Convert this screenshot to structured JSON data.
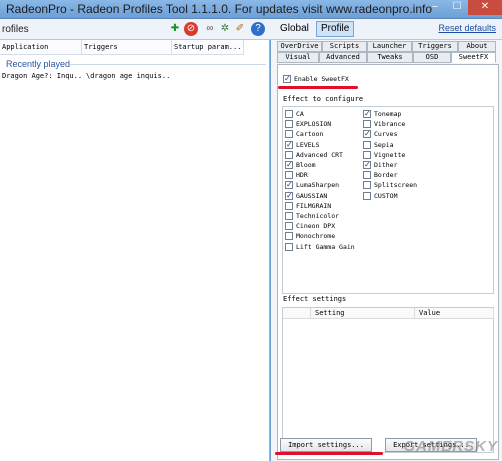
{
  "window": {
    "title": "RadeonPro - Radeon Profiles Tool 1.1.1.0. For updates visit www.radeonpro.info",
    "minimize": "–",
    "maximize": "☐",
    "close": "✕"
  },
  "toolbar": {
    "left_label": "rofiles",
    "icons": [
      "add-profile-icon",
      "delete-icon",
      "link-icon",
      "tools-icon",
      "broom-icon",
      "help-icon"
    ],
    "global_label": "Global",
    "profile_label": "Profile",
    "reset_label": "Reset defaults"
  },
  "profiles": {
    "columns": [
      "Application",
      "Triggers",
      "Startup param..."
    ],
    "group": "Recently played",
    "rows": [
      {
        "application": "Dragon Age?: Inqu...",
        "triggers": "\\dragon age inquis...",
        "startup": ""
      }
    ]
  },
  "tabs": {
    "row1": [
      "OverDrive",
      "Scripts",
      "Launcher",
      "Triggers",
      "About"
    ],
    "row2": [
      "Visual",
      "Advanced",
      "Tweaks",
      "OSD",
      "SweetFX"
    ],
    "active": "SweetFX"
  },
  "sweetfx": {
    "enable_label": "Enable SweetFX",
    "enabled": true,
    "effects_title": "Effect to configure",
    "effects_left": [
      {
        "label": "CA",
        "checked": false
      },
      {
        "label": "EXPLOSION",
        "checked": false
      },
      {
        "label": "Cartoon",
        "checked": false
      },
      {
        "label": "LEVELS",
        "checked": true
      },
      {
        "label": "Advanced CRT",
        "checked": false
      },
      {
        "label": "Bloom",
        "checked": true
      },
      {
        "label": "HDR",
        "checked": false
      },
      {
        "label": "LumaSharpen",
        "checked": true
      },
      {
        "label": "GAUSSIAN",
        "checked": true
      },
      {
        "label": "FILMGRAIN",
        "checked": false
      },
      {
        "label": "Technicolor",
        "checked": false
      },
      {
        "label": "Cineon DPX",
        "checked": false
      },
      {
        "label": "Monochrome",
        "checked": false
      },
      {
        "label": "Lift Gamma Gain",
        "checked": false
      }
    ],
    "effects_right": [
      {
        "label": "Tonemap",
        "checked": true
      },
      {
        "label": "Vibrance",
        "checked": false
      },
      {
        "label": "Curves",
        "checked": true
      },
      {
        "label": "Sepia",
        "checked": false
      },
      {
        "label": "Vignette",
        "checked": false
      },
      {
        "label": "Dither",
        "checked": true
      },
      {
        "label": "Border",
        "checked": false
      },
      {
        "label": "Splitscreen",
        "checked": false
      },
      {
        "label": "CUSTOM",
        "checked": false
      }
    ],
    "settings_title": "Effect settings",
    "settings_columns": [
      "Setting",
      "Value"
    ],
    "import_label": "Import settings...",
    "export_label": "Export settings..."
  },
  "colors": {
    "titlebar": "#6d9fd6",
    "accent_link": "#1a4fa3",
    "highlight": "#e0102a"
  },
  "watermark": "GAMERSKY"
}
